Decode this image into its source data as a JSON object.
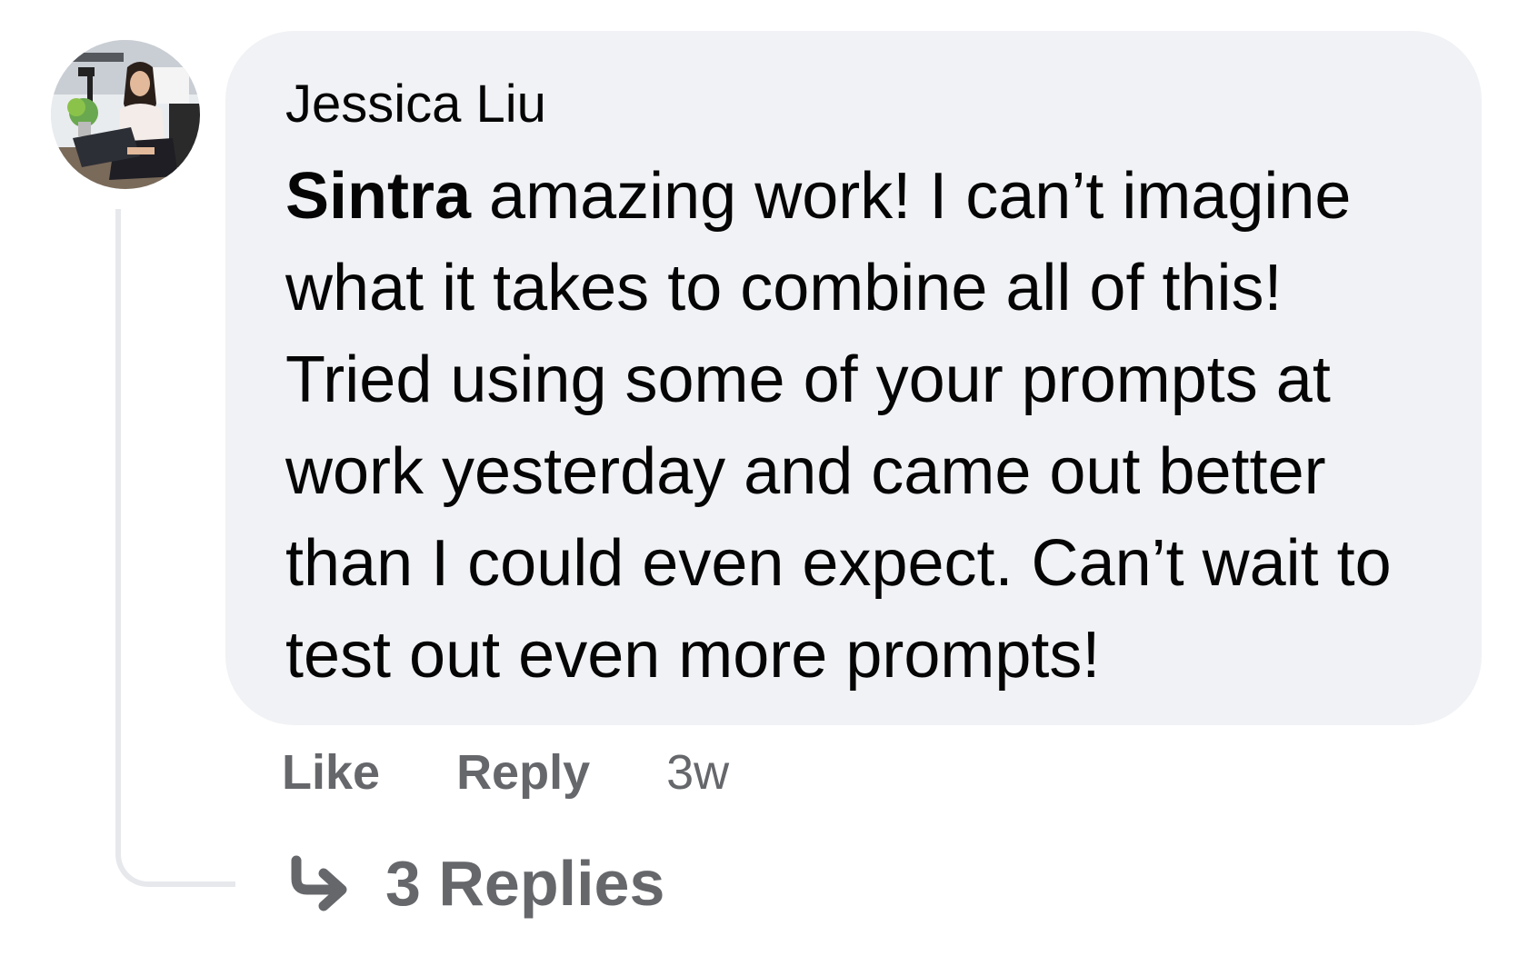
{
  "comment": {
    "author": "Jessica Liu",
    "mention": "Sintra",
    "body": " amazing work! I can’t imagine what it takes to combine all of this! Tried using some of your prompts at work yesterday and came out better than I could even expect. Can’t wait to test out even more prompts!",
    "avatar_icon": "profile-photo"
  },
  "actions": {
    "like_label": "Like",
    "reply_label": "Reply",
    "timestamp": "3w"
  },
  "replies": {
    "icon": "reply-arrow-icon",
    "label": "3 Replies"
  },
  "colors": {
    "bubble": "#f0f2f5",
    "text": "#050505",
    "secondary": "#65676b",
    "thread_line": "#e6e8ec"
  }
}
